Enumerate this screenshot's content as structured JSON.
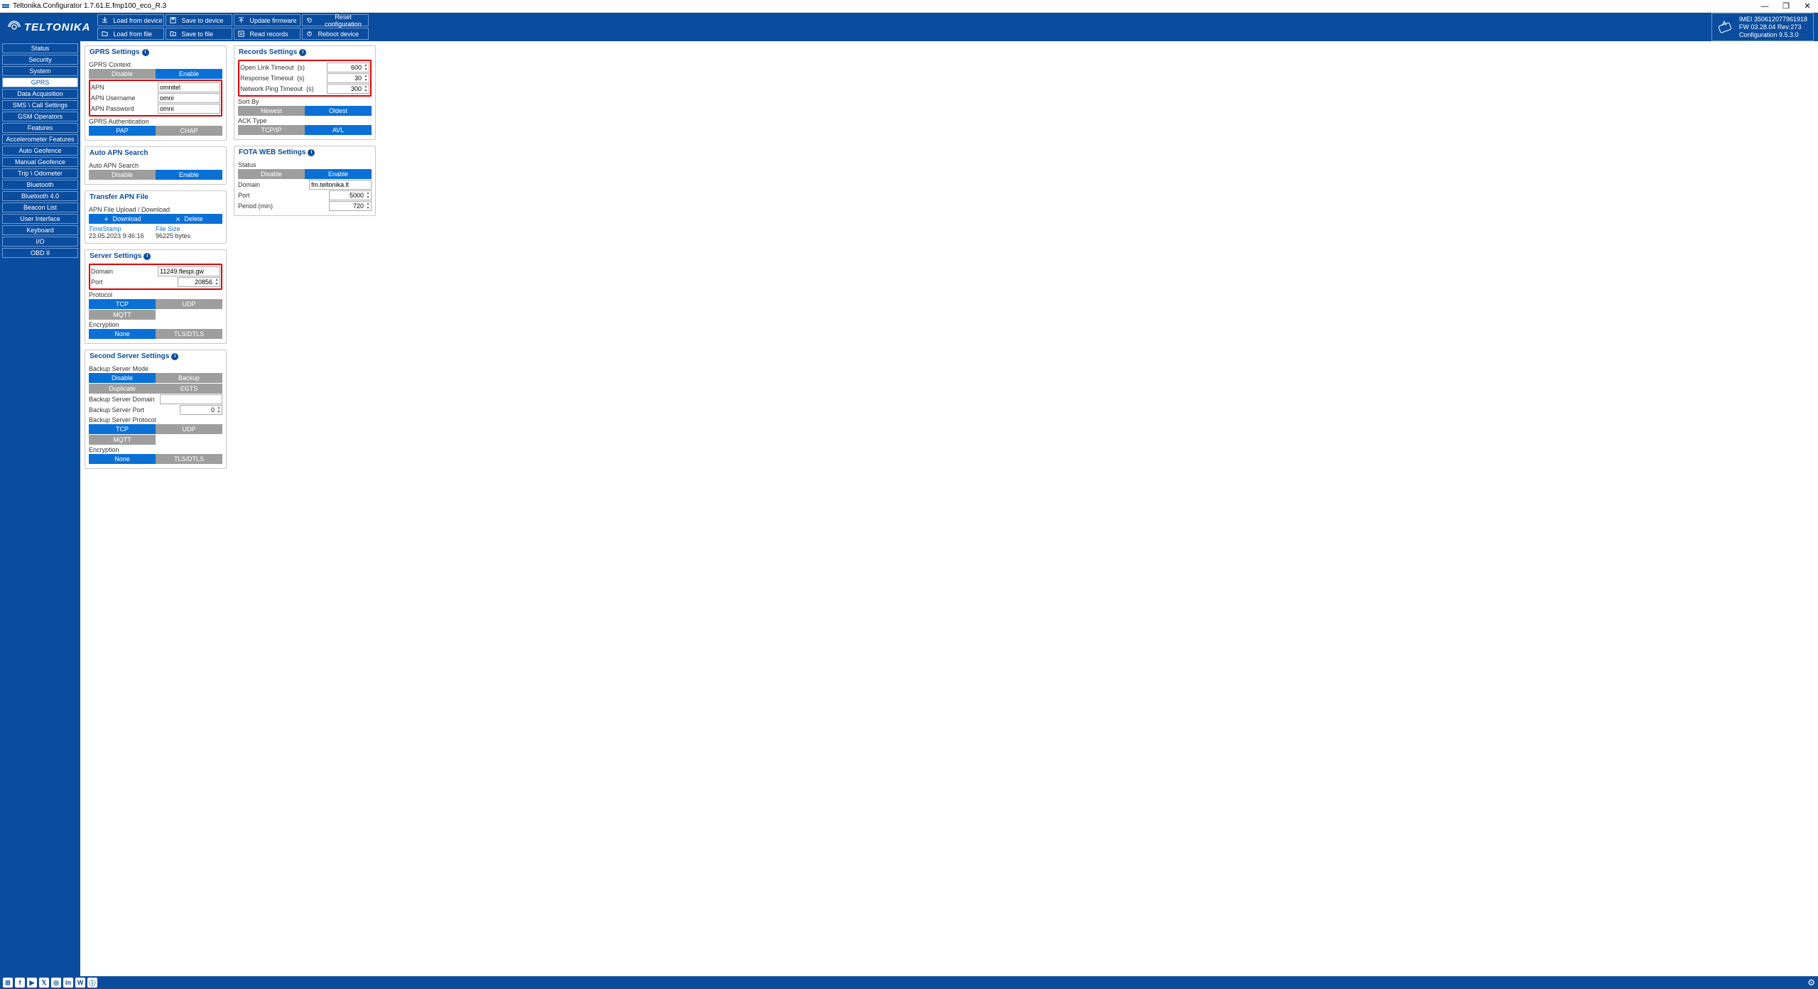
{
  "window": {
    "title": "Teltonika.Configurator 1.7.61.E.fmp100_eco_R.3",
    "minimize": "—",
    "maximize": "❐",
    "close": "✕"
  },
  "header": {
    "logo": "TELTONIKA",
    "buttons_row1": {
      "load_device": "Load from device",
      "save_device": "Save to device",
      "update_fw": "Update firmware",
      "reset_cfg": "Reset configuration"
    },
    "buttons_row2": {
      "load_file": "Load from file",
      "save_file": "Save to file",
      "read_records": "Read records",
      "reboot": "Reboot device"
    },
    "device": {
      "imei_label": "IMEI",
      "imei": "350612077961918",
      "fw_label": "FW",
      "fw": "03.28.04 Rev:273",
      "cfg_label": "Configuration",
      "cfg": "9.5.3.0"
    }
  },
  "sidebar": [
    "Status",
    "Security",
    "System",
    "GPRS",
    "Data Acquisition",
    "SMS \\ Call Settings",
    "GSM Operators",
    "Features",
    "Accelerometer Features",
    "Auto Geofence",
    "Manual Geofence",
    "Trip \\ Odometer",
    "Bluetooth",
    "Bluetooth 4.0",
    "Beacon List",
    "User Interface",
    "Keyboard",
    "I/O",
    "OBD II"
  ],
  "sidebar_active": 3,
  "gprs": {
    "title": "GPRS Settings",
    "context_label": "GPRS Context",
    "disable": "Disable",
    "enable": "Enable",
    "apn_label": "APN",
    "apn": "omnitel",
    "apn_user_label": "APN Username",
    "apn_user": "omni",
    "apn_pass_label": "APN Password",
    "apn_pass": "omni",
    "auth_label": "GPRS Authentication",
    "pap": "PAP",
    "chap": "CHAP"
  },
  "autoapn": {
    "title": "Auto APN Search",
    "label": "Auto APN Search",
    "disable": "Disable",
    "enable": "Enable"
  },
  "transfer": {
    "title": "Transfer APN File",
    "upload_label": "APN File Upload / Download",
    "download": "Download",
    "delete": "Delete",
    "ts_label": "TimeStamp",
    "ts": "23.05.2023 9:46:16",
    "fs_label": "File Size",
    "fs": "96225 bytes"
  },
  "server": {
    "title": "Server Settings",
    "domain_label": "Domain",
    "domain": "11249.flespi.gw",
    "port_label": "Port",
    "port": "20856",
    "protocol_label": "Protocol",
    "tcp": "TCP",
    "udp": "UDP",
    "mqtt": "MQTT",
    "enc_label": "Encryption",
    "none": "None",
    "tls": "TLS/DTLS"
  },
  "second": {
    "title": "Second Server Settings",
    "mode_label": "Backup Server Mode",
    "disable": "Disable",
    "backup": "Backup",
    "duplicate": "Duplicate",
    "egts": "EGTS",
    "domain_label": "Backup Server Domain",
    "domain": "",
    "port_label": "Backup Server Port",
    "port": "0",
    "protocol_label": "Backup Server Protocol",
    "tcp": "TCP",
    "udp": "UDP",
    "mqtt": "MQTT",
    "enc_label": "Encryption",
    "none": "None",
    "tls": "TLS/DTLS"
  },
  "records": {
    "title": "Records Settings",
    "olt_label": "Open Link Timeout",
    "olt_unit": "(s)",
    "olt": "600",
    "rt_label": "Response Timeout",
    "rt_unit": "(s)",
    "rt": "30",
    "npt_label": "Network Ping Timeout",
    "npt_unit": "(s)",
    "npt": "300",
    "sort_label": "Sort By",
    "newest": "Newest",
    "oldest": "Oldest",
    "ack_label": "ACK Type",
    "tcpip": "TCP/IP",
    "avl": "AVL"
  },
  "fota": {
    "title": "FOTA WEB Settings",
    "status_label": "Status",
    "disable": "Disable",
    "enable": "Enable",
    "domain_label": "Domain",
    "domain": "fm.teltonika.lt",
    "port_label": "Port",
    "port": "5000",
    "period_label": "Period (min)",
    "period": "720"
  }
}
